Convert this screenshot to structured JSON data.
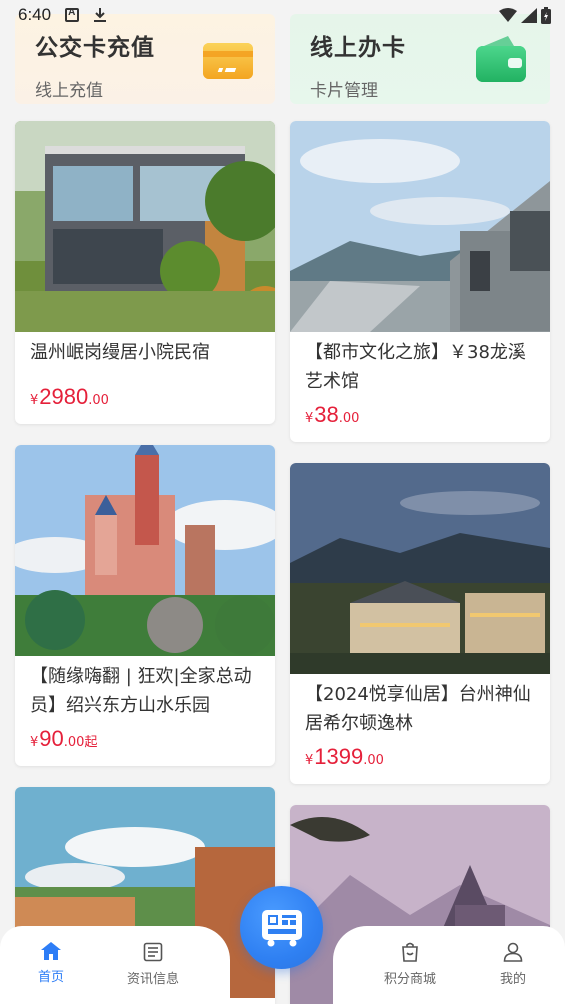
{
  "status_bar": {
    "time": "6:40",
    "icons": [
      "accessibility-icon",
      "download-icon",
      "wifi-icon",
      "signal-icon",
      "battery-icon"
    ]
  },
  "top_cards": [
    {
      "title": "公交卡充值",
      "subtitle": "线上充值",
      "icon": "card-icon",
      "bg": "#fdf3e2",
      "icon_color": "#f7b42c"
    },
    {
      "title": "线上办卡",
      "subtitle": "卡片管理",
      "icon": "wallet-icon",
      "bg": "#e6f5ea",
      "icon_color": "#2fbf73"
    }
  ],
  "products": {
    "left": [
      {
        "title": "温州岷岗缦居小院民宿",
        "currency": "¥",
        "price_int": "2980",
        "price_dec": ".00",
        "suffix": ""
      },
      {
        "title": "【随缘嗨翻 | 狂欢|全家总动员】绍兴东方山水乐园",
        "currency": "¥",
        "price_int": "90",
        "price_dec": ".00",
        "suffix": "起"
      },
      {
        "title": "",
        "currency": "",
        "price_int": "",
        "price_dec": "",
        "suffix": ""
      }
    ],
    "right": [
      {
        "title": "【都市文化之旅】￥38龙溪艺术馆",
        "currency": "¥",
        "price_int": "38",
        "price_dec": ".00",
        "suffix": ""
      },
      {
        "title": "【2024悦享仙居】台州神仙居希尔顿逸林",
        "currency": "¥",
        "price_int": "1399",
        "price_dec": ".00",
        "suffix": ""
      },
      {
        "title": "",
        "currency": "",
        "price_int": "",
        "price_dec": "",
        "suffix": ""
      }
    ]
  },
  "bottom_nav": {
    "items": [
      {
        "label": "首页",
        "icon": "home-icon",
        "active": true
      },
      {
        "label": "资讯信息",
        "icon": "news-icon",
        "active": false
      },
      {
        "label": "积分商城",
        "icon": "shopping-bag-icon",
        "active": false
      },
      {
        "label": "我的",
        "icon": "user-icon",
        "active": false
      }
    ],
    "center_button_icon": "bus-qrcode-icon"
  },
  "colors": {
    "accent": "#2d7df6",
    "price": "#e5203a"
  }
}
